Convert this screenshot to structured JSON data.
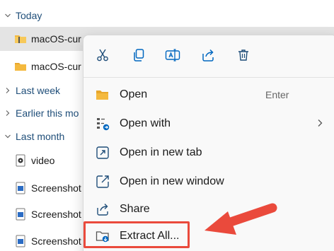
{
  "explorer": {
    "groups": {
      "today": "Today",
      "last_week": "Last week",
      "earlier_this_month": "Earlier this mo",
      "last_month": "Last month"
    },
    "files": {
      "zip_selected": "macOS-cur",
      "folder": "macOS-cur",
      "video": "video",
      "screenshot_1": "Screenshot",
      "screenshot_2": "Screenshot",
      "screenshot_3": "Screenshot"
    }
  },
  "context_menu": {
    "toolbar_icons": [
      "cut-icon",
      "copy-icon",
      "rename-icon",
      "share-icon",
      "delete-icon"
    ],
    "items": {
      "open": {
        "label": "Open",
        "shortcut": "Enter"
      },
      "open_with": {
        "label": "Open with"
      },
      "open_new_tab": {
        "label": "Open in new tab"
      },
      "open_new_window": {
        "label": "Open in new window"
      },
      "share": {
        "label": "Share"
      },
      "extract_all": {
        "label": "Extract All..."
      }
    }
  },
  "colors": {
    "group_header": "#1f4e79",
    "accent_blue": "#0067c0",
    "annotation_red": "#ea4a3c",
    "folder_yellow": "#f4b93e",
    "selection_gray": "#e4e4e4"
  }
}
